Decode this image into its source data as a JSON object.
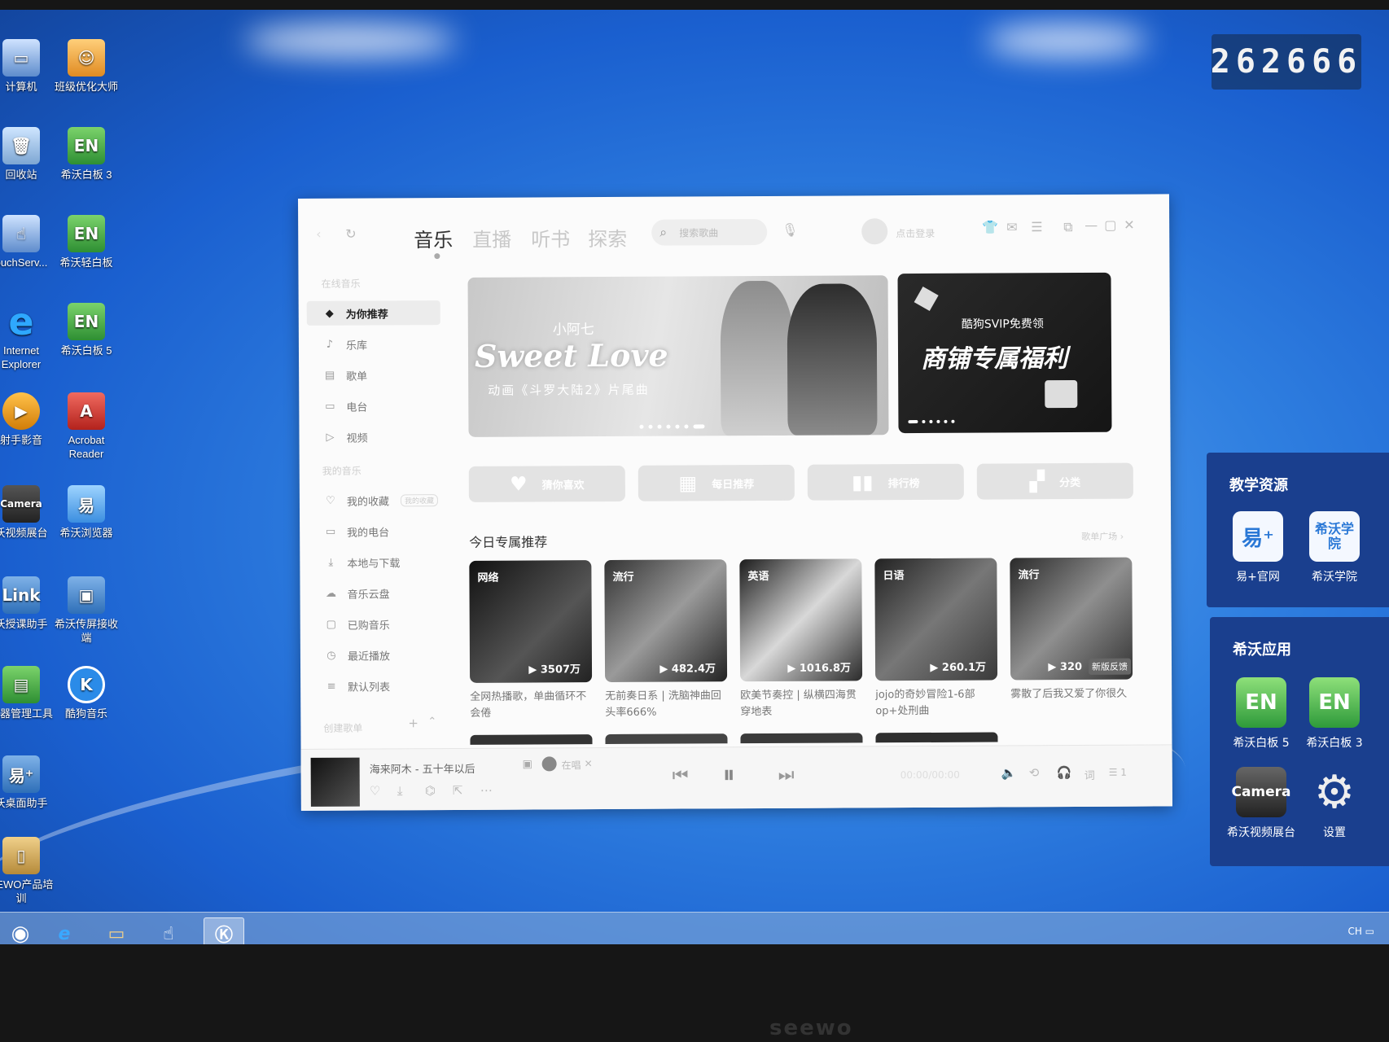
{
  "screen_counter": "262666",
  "bezel_brand": "seewo",
  "desktop_icons": [
    {
      "label": "计算机",
      "icon": "computer-icon"
    },
    {
      "label": "班级优化大师",
      "icon": "monkey-app-icon"
    },
    {
      "label": "回收站",
      "icon": "recycle-bin-icon"
    },
    {
      "label": "希沃白板 3",
      "icon": "en-icon"
    },
    {
      "label": "ouchServ...",
      "icon": "touch-service-icon"
    },
    {
      "label": "希沃轻白板",
      "icon": "en-icon"
    },
    {
      "label": "Internet Explorer",
      "icon": "ie-icon"
    },
    {
      "label": "希沃白板 5",
      "icon": "en-icon"
    },
    {
      "label": "射手影音",
      "icon": "media-player-icon"
    },
    {
      "label": "Acrobat Reader",
      "icon": "acrobat-icon"
    },
    {
      "label": "沃视频展台",
      "icon": "camera-icon"
    },
    {
      "label": "希沃浏览器",
      "icon": "browser-icon"
    },
    {
      "label": "沃授课助手",
      "icon": "link-icon"
    },
    {
      "label": "希沃传屏接收端",
      "icon": "screen-share-icon"
    },
    {
      "label": "驱器管理工具",
      "icon": "manager-icon"
    },
    {
      "label": "酷狗音乐",
      "icon": "kugou-icon"
    },
    {
      "label": "沃桌面助手",
      "icon": "desktop-assistant-icon"
    },
    {
      "label": "EEWO产品培训",
      "icon": "folder-icon"
    }
  ],
  "panels": {
    "teaching": {
      "title": "教学资源",
      "apps": [
        {
          "label": "易+官网",
          "glyph": "易⁺"
        },
        {
          "label": "希沃学院",
          "glyph": "希沃学院"
        }
      ]
    },
    "apps": {
      "title": "希沃应用",
      "apps": [
        {
          "label": "希沃白板 5",
          "glyph": "EN"
        },
        {
          "label": "希沃白板 3",
          "glyph": "EN"
        },
        {
          "label": "希沃视频展台",
          "glyph": "Camera"
        },
        {
          "label": "设置",
          "glyph": "⚙"
        }
      ]
    }
  },
  "taskbar": {
    "tray_text": "CH"
  },
  "app": {
    "tabs": [
      "音乐",
      "直播",
      "听书",
      "探索"
    ],
    "active_tab": "音乐",
    "search_placeholder": "搜索歌曲",
    "login_text": "点击登录",
    "sidebar": {
      "section1": "在线音乐",
      "items1": [
        "为你推荐",
        "乐库",
        "歌单",
        "电台",
        "视频"
      ],
      "section2": "我的音乐",
      "items2": [
        "我的收藏",
        "我的电台",
        "本地与下载",
        "音乐云盘",
        "已购音乐",
        "最近播放",
        "默认列表"
      ],
      "collect_badge": "我的收藏",
      "section3": "创建歌单"
    },
    "banner_main": {
      "artist": "小阿七",
      "title": "Sweet Love",
      "subtitle": "动画《斗罗大陆2》片尾曲"
    },
    "banner_side": {
      "top": "酷狗SVIP免费领",
      "title": "商铺专属福利"
    },
    "quick_buttons": [
      {
        "label": "猜你喜欢",
        "icon": "heart-icon"
      },
      {
        "label": "每日推荐",
        "icon": "calendar-icon"
      },
      {
        "label": "排行榜",
        "icon": "chart-icon"
      },
      {
        "label": "分类",
        "icon": "grid-icon"
      }
    ],
    "section_title": "今日专属推荐",
    "section_more": "歌单广场 ›",
    "cards": [
      {
        "tag": "网络",
        "plays": "3507万",
        "title": "全网热播歌，单曲循环不会倦"
      },
      {
        "tag": "流行",
        "plays": "482.4万",
        "title": "无前奏日系 | 洗脑神曲回头率666%"
      },
      {
        "tag": "英语",
        "plays": "1016.8万",
        "title": "欧美节奏控 | 纵横四海贯穿地表"
      },
      {
        "tag": "日语",
        "plays": "260.1万",
        "title": "jojo的奇妙冒险1-6部op+处刑曲"
      },
      {
        "tag": "流行",
        "plays": "320",
        "title": "雾散了后我又爱了你很久",
        "badge": "新版反馈"
      }
    ],
    "player": {
      "song": "海来阿木 - 五十年以后",
      "singer_tag": "在唱",
      "time": "00:00/00:00",
      "lyric_btn": "词",
      "queue_count": "1"
    }
  }
}
